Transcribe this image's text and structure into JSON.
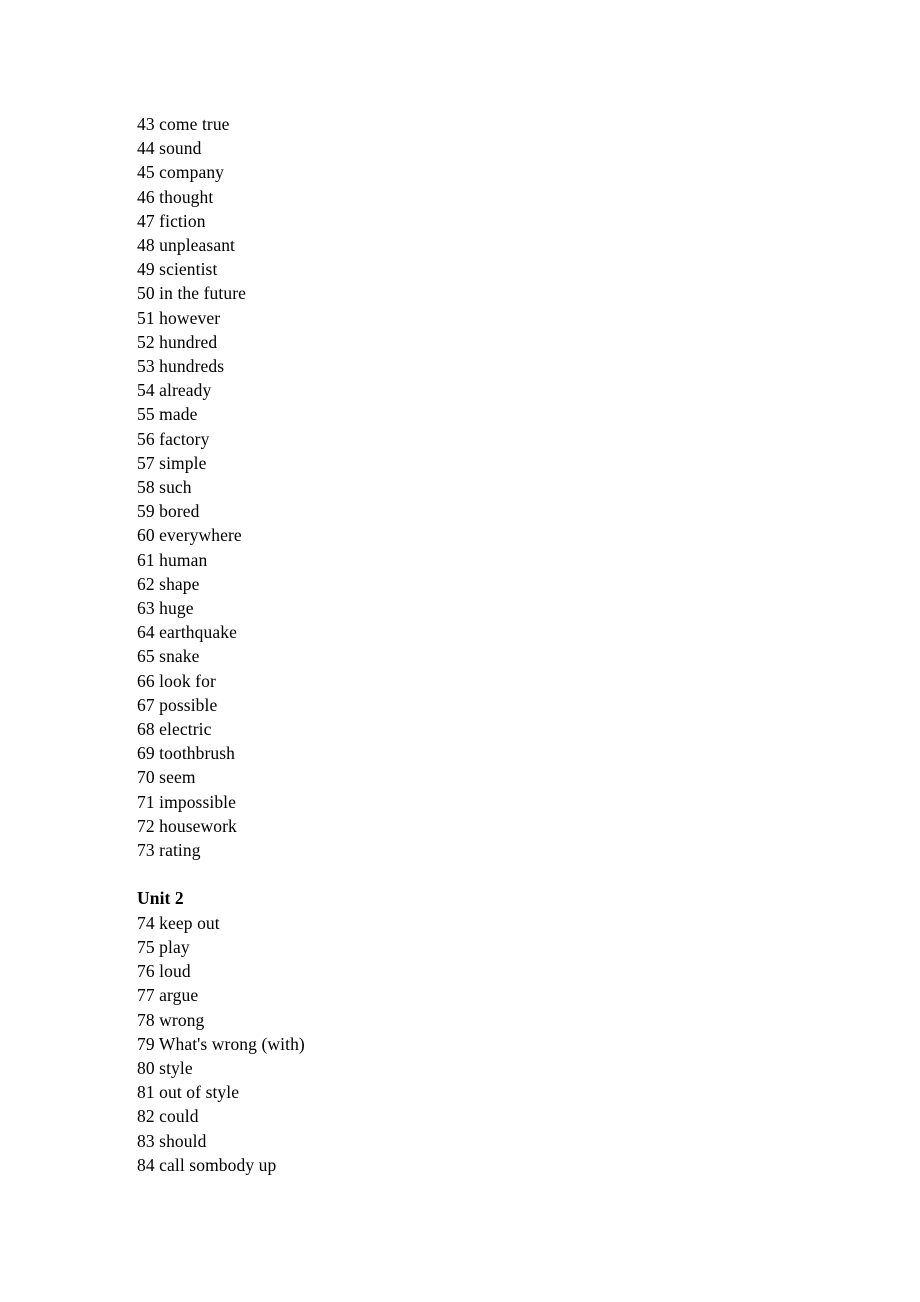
{
  "page": {
    "background_color": "#ffffff",
    "text_color": "#000000"
  },
  "sections": [
    {
      "heading": null,
      "items": [
        {
          "number": "43",
          "word": "come true"
        },
        {
          "number": "44",
          "word": "sound"
        },
        {
          "number": "45",
          "word": "company"
        },
        {
          "number": "46",
          "word": "thought"
        },
        {
          "number": "47",
          "word": "fiction"
        },
        {
          "number": "48",
          "word": "unpleasant"
        },
        {
          "number": "49",
          "word": "scientist"
        },
        {
          "number": "50",
          "word": "in the future"
        },
        {
          "number": "51",
          "word": "however"
        },
        {
          "number": "52",
          "word": "hundred"
        },
        {
          "number": "53",
          "word": "hundreds"
        },
        {
          "number": "54",
          "word": "already"
        },
        {
          "number": "55",
          "word": "made"
        },
        {
          "number": "56",
          "word": "factory"
        },
        {
          "number": "57",
          "word": "simple"
        },
        {
          "number": "58",
          "word": "such"
        },
        {
          "number": "59",
          "word": "bored"
        },
        {
          "number": "60",
          "word": "everywhere"
        },
        {
          "number": "61",
          "word": "human"
        },
        {
          "number": "62",
          "word": "shape"
        },
        {
          "number": "63",
          "word": "huge"
        },
        {
          "number": "64",
          "word": "earthquake"
        },
        {
          "number": "65",
          "word": "snake"
        },
        {
          "number": "66",
          "word": "look for"
        },
        {
          "number": "67",
          "word": "possible"
        },
        {
          "number": "68",
          "word": "electric"
        },
        {
          "number": "69",
          "word": "toothbrush"
        },
        {
          "number": "70",
          "word": "seem"
        },
        {
          "number": "71",
          "word": "impossible"
        },
        {
          "number": "72",
          "word": "housework"
        },
        {
          "number": "73",
          "word": "rating"
        }
      ]
    },
    {
      "heading": "Unit 2",
      "items": [
        {
          "number": "74",
          "word": "keep out"
        },
        {
          "number": "75",
          "word": "play"
        },
        {
          "number": "76",
          "word": "loud"
        },
        {
          "number": "77",
          "word": "argue"
        },
        {
          "number": "78",
          "word": "wrong"
        },
        {
          "number": "79",
          "word": "What's wrong (with)"
        },
        {
          "number": "80",
          "word": "style"
        },
        {
          "number": "81",
          "word": "out of style"
        },
        {
          "number": "82",
          "word": "could"
        },
        {
          "number": "83",
          "word": "should"
        },
        {
          "number": "84",
          "word": "call sombody up"
        }
      ]
    }
  ],
  "lines": [
    "43 come true",
    "44 sound",
    "45 company",
    "46 thought",
    "47 fiction",
    "48 unpleasant",
    "49 scientist",
    "50 in the future",
    "51 however",
    "52 hundred",
    "53 hundreds",
    "54 already",
    "55 made",
    "56 factory",
    "57 simple",
    "58 such",
    "59 bored",
    "60 everywhere",
    "61 human",
    "62 shape",
    "63 huge",
    "64 earthquake",
    "65 snake",
    "66 look for",
    "67 possible",
    "68 electric",
    "69 toothbrush",
    "70 seem",
    "71 impossible",
    "72 housework",
    "73 rating"
  ],
  "unit_heading": "Unit 2",
  "lines_unit2": [
    "74 keep out",
    "75 play",
    "76 loud",
    "77 argue",
    "78 wrong",
    "79 What's wrong (with)",
    "80 style",
    "81 out of style",
    "82 could",
    "83 should",
    "84 call sombody up"
  ]
}
